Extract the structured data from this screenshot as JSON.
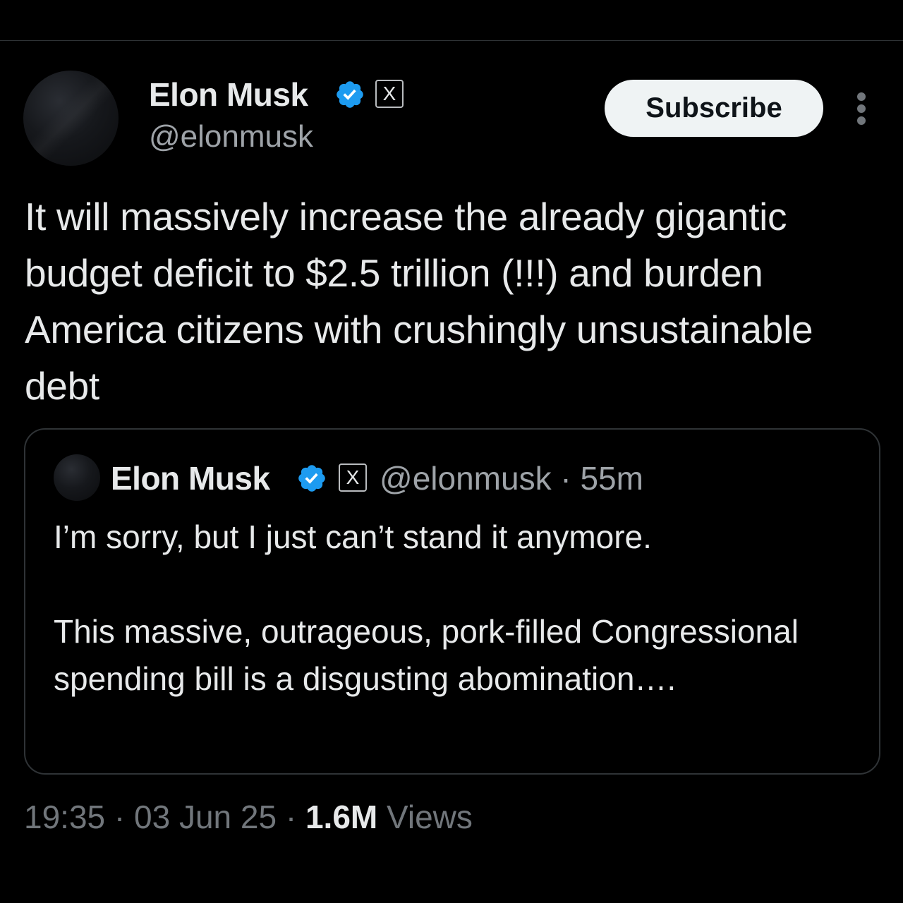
{
  "tweet": {
    "author": {
      "name": "Elon Musk",
      "handle": "@elonmusk",
      "verified": true,
      "affiliate_badge": "X"
    },
    "subscribe_label": "Subscribe",
    "more_icon": "more-vertical-icon",
    "text": "It will massively increase the already gigantic budget deficit to $2.5 trillion (!!!) and burden America citizens with crushingly unsustainable debt",
    "quoted": {
      "author_name": "Elon Musk",
      "affiliate_badge": "X",
      "handle": "@elonmusk",
      "separator": "·",
      "age": "55m",
      "text": "I’m sorry, but I just can’t stand it anymore.\n\nThis massive, outrageous, pork-filled Congressional spending bill is a disgusting abomination…."
    },
    "time": "19:35",
    "date": "03 Jun 25",
    "separator": "·",
    "views_count": "1.6M",
    "views_label": "Views"
  },
  "colors": {
    "background": "#000000",
    "text_primary": "#e7e9ea",
    "text_secondary": "#71767b",
    "verified_blue": "#1d9bf0",
    "border": "#2f3336",
    "button_bg": "#eff3f4"
  }
}
